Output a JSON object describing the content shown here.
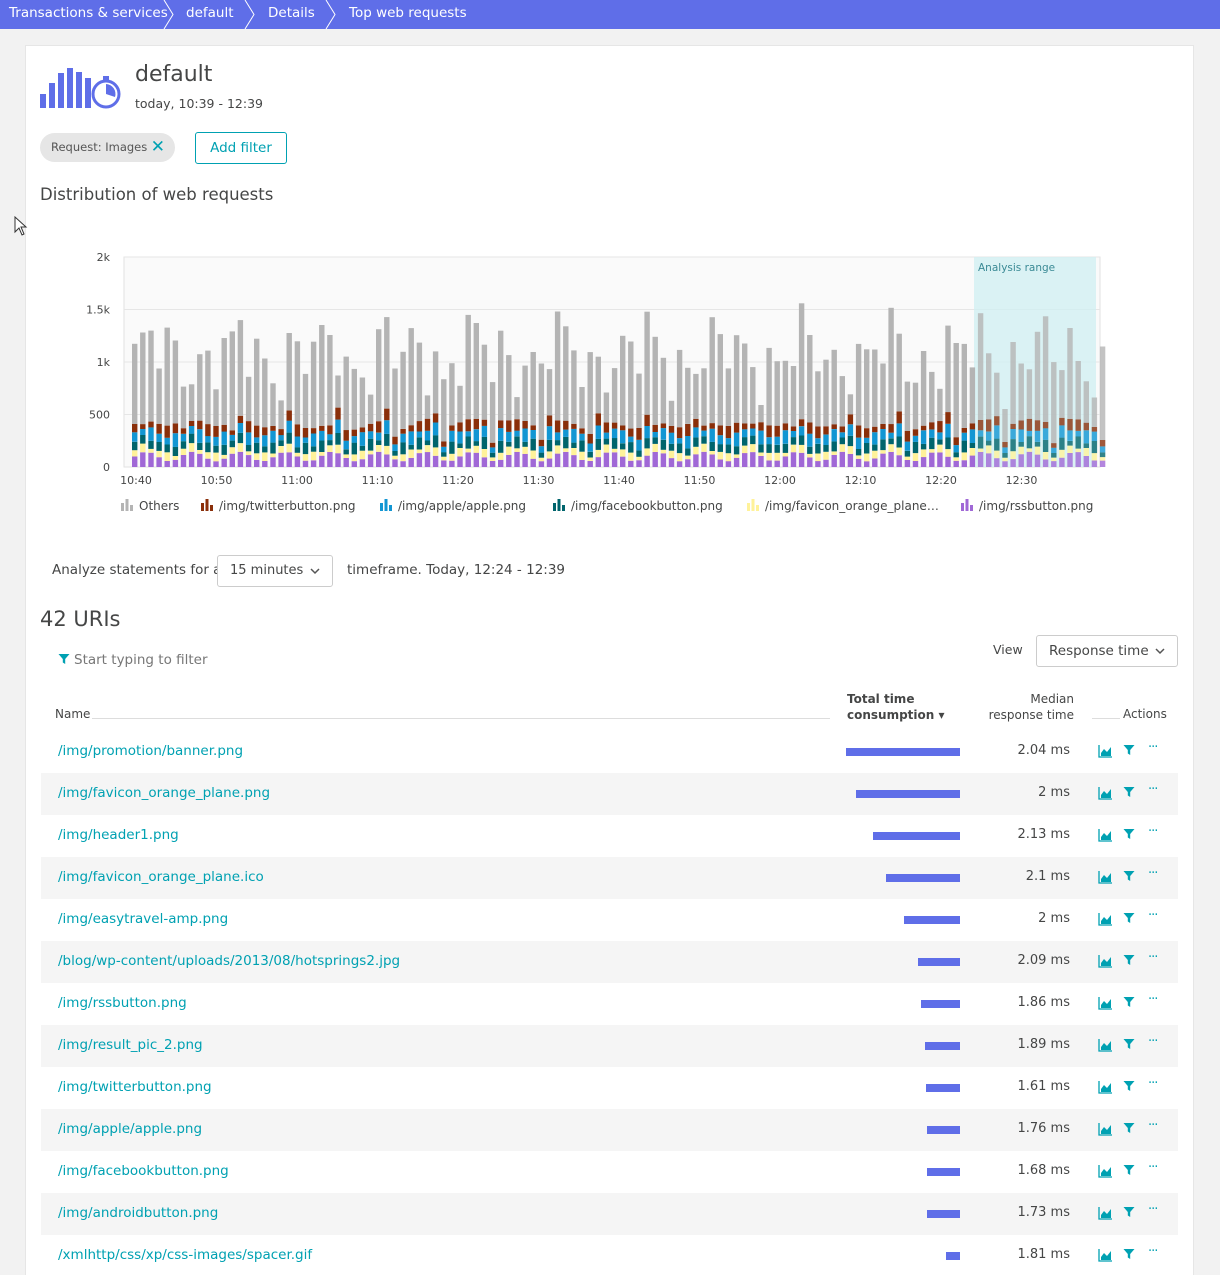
{
  "breadcrumb": [
    "Transactions & services",
    "default",
    "Details",
    "Top web requests"
  ],
  "header": {
    "title": "default",
    "subtitle": "today, 10:39 - 12:39"
  },
  "filters": {
    "chip_label": "Request: Images",
    "add_filter_label": "Add filter"
  },
  "section_title": "Distribution of web requests",
  "colors": {
    "accent": "#5f6ee8",
    "link": "#00a1b2",
    "others": "#b4b4b4",
    "twitter": "#8a2f0a",
    "apple": "#1296d3",
    "facebook": "#00646c",
    "favicon": "#fff29a",
    "rss": "#a068d6"
  },
  "chart_data": {
    "type": "bar",
    "stacked": true,
    "ylim": [
      0,
      2000
    ],
    "yticks": [
      "0",
      "500",
      "1k",
      "1.5k",
      "2k"
    ],
    "xticks": [
      "10:40",
      "10:50",
      "11:00",
      "11:10",
      "11:20",
      "11:30",
      "11:40",
      "11:50",
      "12:00",
      "12:10",
      "12:20",
      "12:30"
    ],
    "annotation": "Analysis range",
    "legend_position": "bottom",
    "series": [
      {
        "name": "Others",
        "approx_value": 650
      },
      {
        "name": "/img/twitterbutton.png",
        "approx_value": 80
      },
      {
        "name": "/img/apple/apple.png",
        "approx_value": 90
      },
      {
        "name": "/img/facebookbutton.png",
        "approx_value": 80
      },
      {
        "name": "/img/favicon_orange_plane…",
        "approx_value": 60
      },
      {
        "name": "/img/rssbutton.png",
        "approx_value": 100
      }
    ]
  },
  "analyze": {
    "label": "Analyze statements for a",
    "select_value": "15 minutes",
    "timeframe": "timeframe. Today, 12:24 - 12:39"
  },
  "uri_count": "42 URIs",
  "filter_placeholder": "Start typing to filter",
  "view": {
    "label": "View",
    "value": "Response time"
  },
  "table": {
    "col_name": "Name",
    "col_total_line1": "Total time",
    "col_total_line2": "consumption ▾",
    "col_median_line1": "Median",
    "col_median_line2": "response time",
    "col_actions": "Actions",
    "rows": [
      {
        "name": "/img/promotion/banner.png",
        "share": 1.0,
        "median": "2.04 ms"
      },
      {
        "name": "/img/favicon_orange_plane.png",
        "share": 0.91,
        "median": "2 ms"
      },
      {
        "name": "/img/header1.png",
        "share": 0.76,
        "median": "2.13 ms"
      },
      {
        "name": "/img/favicon_orange_plane.ico",
        "share": 0.65,
        "median": "2.1 ms"
      },
      {
        "name": "/img/easytravel-amp.png",
        "share": 0.49,
        "median": "2 ms"
      },
      {
        "name": "/blog/wp-content/uploads/2013/08/hotsprings2.jpg",
        "share": 0.37,
        "median": "2.09 ms"
      },
      {
        "name": "/img/rssbutton.png",
        "share": 0.34,
        "median": "1.86 ms"
      },
      {
        "name": "/img/result_pic_2.png",
        "share": 0.31,
        "median": "1.89 ms"
      },
      {
        "name": "/img/twitterbutton.png",
        "share": 0.3,
        "median": "1.61 ms"
      },
      {
        "name": "/img/apple/apple.png",
        "share": 0.29,
        "median": "1.76 ms"
      },
      {
        "name": "/img/facebookbutton.png",
        "share": 0.29,
        "median": "1.68 ms"
      },
      {
        "name": "/img/androidbutton.png",
        "share": 0.29,
        "median": "1.73 ms"
      },
      {
        "name": "/xmlhttp/css/xp/css-images/spacer.gif",
        "share": 0.12,
        "median": "1.81 ms"
      }
    ]
  }
}
